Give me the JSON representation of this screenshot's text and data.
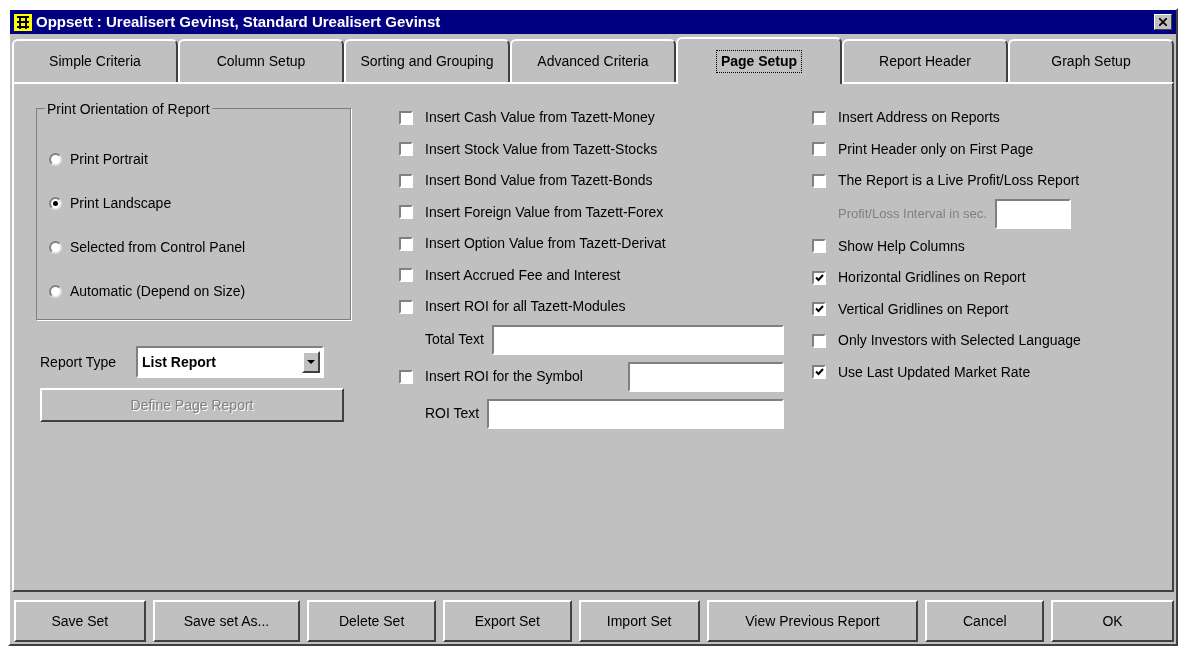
{
  "window": {
    "title": "Oppsett : Urealisert Gevinst, Standard Urealisert Gevinst"
  },
  "tabs": [
    {
      "label": "Simple Criteria",
      "selected": false
    },
    {
      "label": "Column Setup",
      "selected": false
    },
    {
      "label": "Sorting and Grouping",
      "selected": false
    },
    {
      "label": "Advanced Criteria",
      "selected": false
    },
    {
      "label": "Page Setup",
      "selected": true
    },
    {
      "label": "Report Header",
      "selected": false
    },
    {
      "label": "Graph Setup",
      "selected": false
    }
  ],
  "orientation": {
    "title": "Print Orientation of Report",
    "options": [
      {
        "label": "Print Portrait",
        "selected": false
      },
      {
        "label": "Print Landscape",
        "selected": true
      },
      {
        "label": "Selected from Control Panel",
        "selected": false
      },
      {
        "label": "Automatic (Depend on Size)",
        "selected": false
      }
    ]
  },
  "report_type": {
    "label": "Report Type",
    "value": "List Report"
  },
  "define_button": {
    "label": "Define Page Report",
    "disabled": true
  },
  "middle_options": [
    {
      "kind": "checkbox",
      "label": "Insert Cash Value from Tazett-Money",
      "checked": false
    },
    {
      "kind": "checkbox",
      "label": "Insert Stock Value from Tazett-Stocks",
      "checked": false
    },
    {
      "kind": "checkbox",
      "label": "Insert Bond Value from Tazett-Bonds",
      "checked": false
    },
    {
      "kind": "checkbox",
      "label": "Insert Foreign Value from Tazett-Forex",
      "checked": false
    },
    {
      "kind": "checkbox",
      "label": "Insert Option Value from Tazett-Derivat",
      "checked": false
    },
    {
      "kind": "checkbox",
      "label": "Insert Accrued Fee and Interest",
      "checked": false
    },
    {
      "kind": "checkbox",
      "label": "Insert ROI for all Tazett-Modules",
      "checked": false
    },
    {
      "kind": "field",
      "label": "Total Text"
    },
    {
      "kind": "checkbox_field",
      "label": "Insert ROI for the Symbol",
      "checked": false
    },
    {
      "kind": "field",
      "label": "ROI Text"
    }
  ],
  "right_options": [
    {
      "kind": "checkbox",
      "label": "Insert Address on Reports",
      "checked": false
    },
    {
      "kind": "checkbox",
      "label": "Print Header only on First Page",
      "checked": false
    },
    {
      "kind": "checkbox",
      "label": "The Report is a Live Profit/Loss Report",
      "checked": false
    },
    {
      "kind": "field",
      "label": "Profit/Loss Interval in sec.",
      "disabled": true
    },
    {
      "kind": "checkbox",
      "label": "Show Help Columns",
      "checked": false
    },
    {
      "kind": "checkbox",
      "label": "Horizontal Gridlines on Report",
      "checked": true
    },
    {
      "kind": "checkbox",
      "label": "Vertical Gridlines on Report",
      "checked": true
    },
    {
      "kind": "checkbox",
      "label": "Only Investors with Selected Language",
      "checked": false
    },
    {
      "kind": "checkbox",
      "label": "Use Last Updated Market Rate",
      "checked": true
    }
  ],
  "buttons": [
    "Save Set",
    "Save set As...",
    "Delete Set",
    "Export Set",
    "Import Set",
    "View Previous Report",
    "Cancel",
    "OK"
  ]
}
